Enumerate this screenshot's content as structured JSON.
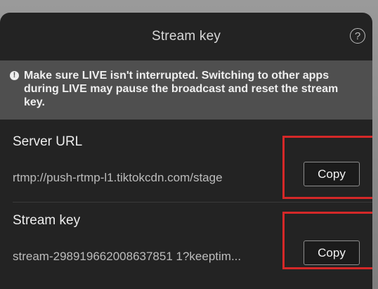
{
  "sheet": {
    "title": "Stream key",
    "help_icon": "question-mark-icon",
    "help_glyph": "?"
  },
  "banner": {
    "icon": "info-icon",
    "icon_glyph": "!",
    "text": "Make sure LIVE isn't interrupted. Switching to other apps during LIVE may pause the broadcast and reset the stream key."
  },
  "server": {
    "label": "Server URL",
    "value": "rtmp://push-rtmp-l1.tiktokcdn.com/stage",
    "copy_label": "Copy"
  },
  "stream": {
    "label": "Stream key",
    "value": "stream-298919662008637851 1?keeptim...",
    "copy_label": "Copy"
  },
  "colors": {
    "sheet_bg": "#232323",
    "banner_bg": "#4f4f4f",
    "highlight": "#d52828"
  }
}
